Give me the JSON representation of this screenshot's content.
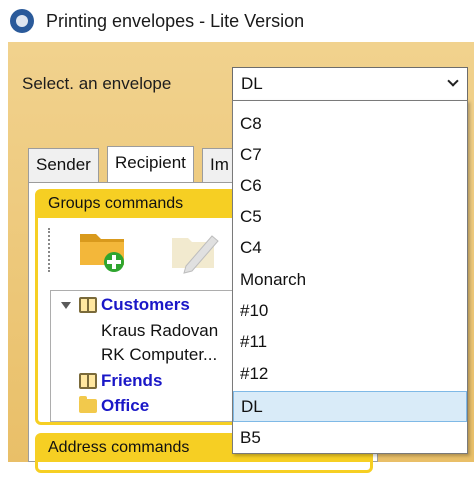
{
  "window": {
    "title": "Printing envelopes  - Lite Version",
    "icon": "app-globe-icon"
  },
  "envelope_select": {
    "label": "Select. an envelope",
    "value": "DL",
    "options": [
      "C8",
      "C7",
      "C6",
      "C5",
      "C4",
      "Monarch",
      "#10",
      "#11",
      "#12",
      "DL",
      "B5"
    ],
    "selected_index": 9
  },
  "tabs": [
    {
      "label": "Sender",
      "active": false
    },
    {
      "label": "Recipient",
      "active": true
    },
    {
      "label": "Im",
      "active": false
    }
  ],
  "groups_panel": {
    "title": "Groups commands",
    "toolbar": [
      {
        "name": "add-folder",
        "icon": "folder-add-icon"
      },
      {
        "name": "edit",
        "icon": "edit-pencil-icon"
      }
    ]
  },
  "tree": [
    {
      "label": "Customers",
      "level": 0,
      "bold": true,
      "expanded": true,
      "icon": "book-icon"
    },
    {
      "label": "Kraus Radovan",
      "level": 1,
      "bold": false
    },
    {
      "label": "RK Computer...",
      "level": 1,
      "bold": false
    },
    {
      "label": "Friends",
      "level": 0,
      "bold": true,
      "icon": "book-icon"
    },
    {
      "label": "Office",
      "level": 0,
      "bold": true,
      "icon": "folder-icon"
    }
  ],
  "address_panel": {
    "title": "Address commands"
  },
  "colors": {
    "panel_bg": "#f1d28e",
    "group_border": "#f6cf23",
    "tree_bold": "#1a17c7",
    "selected_option": "#d9ebf8"
  }
}
